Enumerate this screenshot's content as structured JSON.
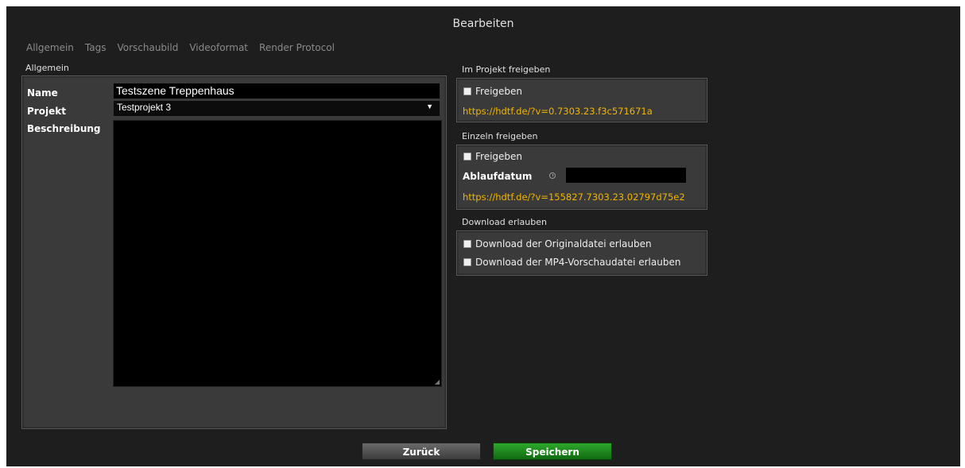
{
  "dialog": {
    "title": "Bearbeiten"
  },
  "tabs": [
    {
      "label": "Allgemein"
    },
    {
      "label": "Tags"
    },
    {
      "label": "Vorschaubild"
    },
    {
      "label": "Videoformat"
    },
    {
      "label": "Render Protocol"
    }
  ],
  "general": {
    "section_label": "Allgemein",
    "name_label": "Name",
    "name_value": "Testszene Treppenhaus",
    "project_label": "Projekt",
    "project_value": "Testprojekt 3",
    "description_label": "Beschreibung",
    "description_value": ""
  },
  "project_share": {
    "section_label": "Im Projekt freigeben",
    "checkbox_label": "Freigeben",
    "checked": false,
    "url": "https://hdtf.de/?v=0.7303.23.f3c571671a"
  },
  "single_share": {
    "section_label": "Einzeln freigeben",
    "checkbox_label": "Freigeben",
    "checked": false,
    "expiry_label": "Ablaufdatum",
    "expiry_value": "",
    "url": "https://hdtf.de/?v=155827.7303.23.02797d75e2",
    "icon": "clock-icon"
  },
  "download": {
    "section_label": "Download erlauben",
    "original_label": "Download der Originaldatei erlauben",
    "original_checked": false,
    "mp4_label": "Download der MP4-Vorschaudatei erlauben",
    "mp4_checked": false
  },
  "footer": {
    "back_label": "Zurück",
    "save_label": "Speichern"
  },
  "colors": {
    "link": "#f0b400",
    "save": "#1f8a1f",
    "background": "#1e1e1e"
  }
}
